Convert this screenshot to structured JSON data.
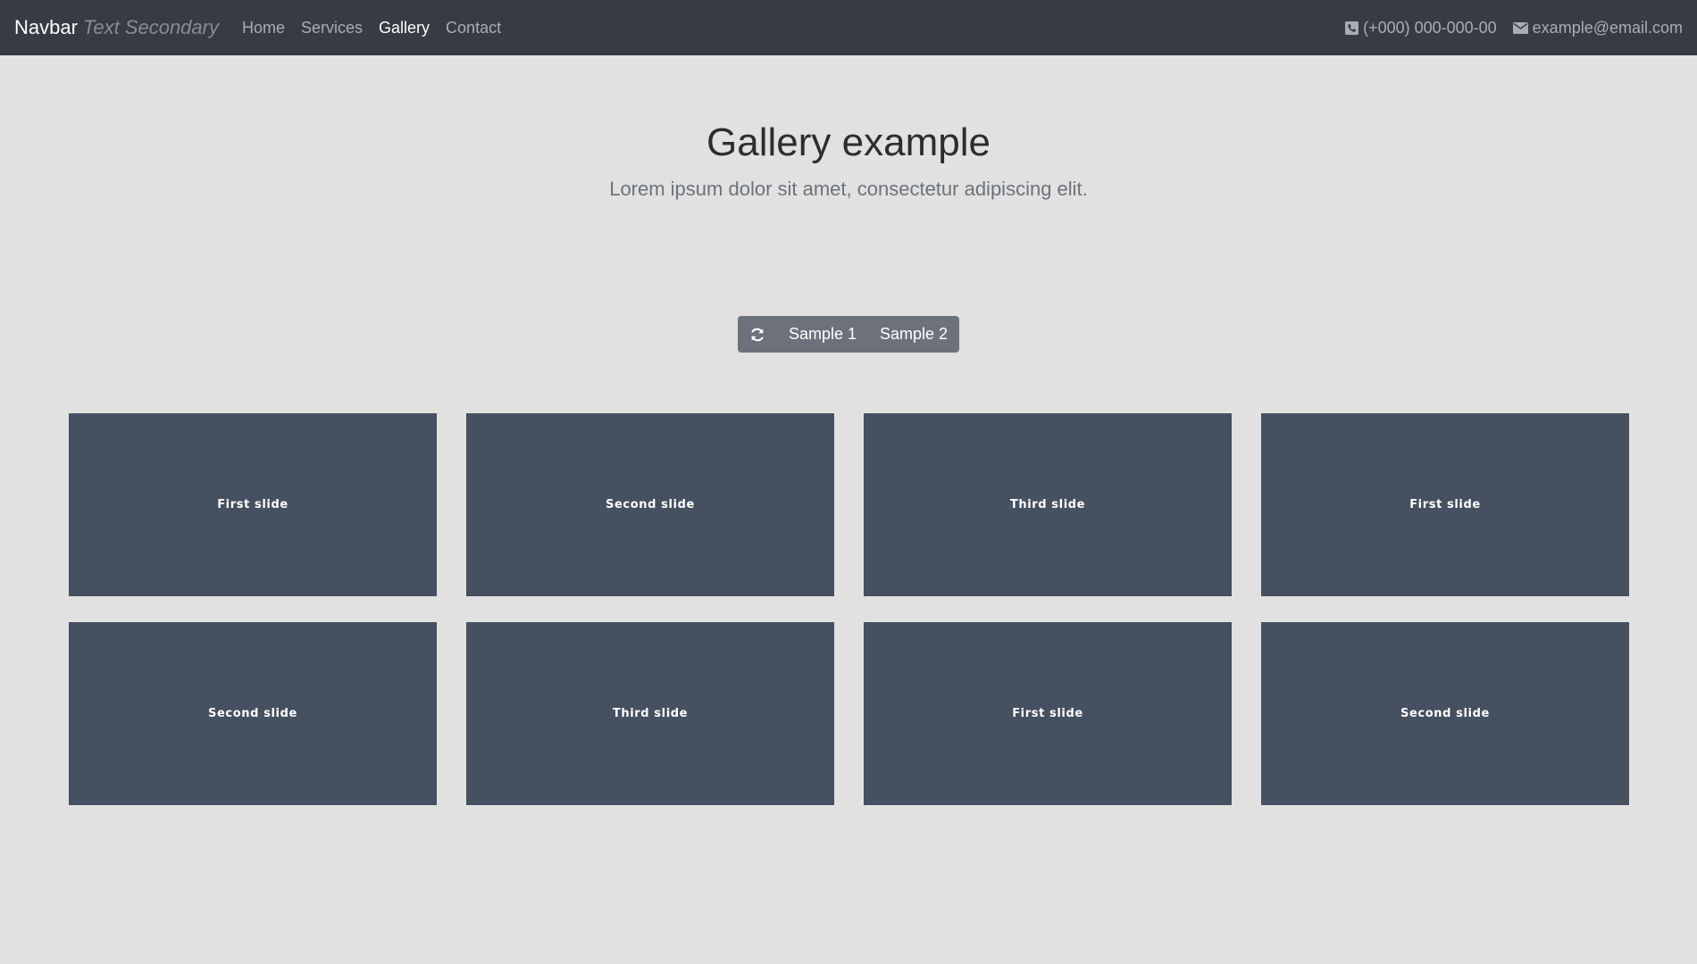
{
  "navbar": {
    "brand": "Navbar",
    "brand_secondary": "Text Secondary",
    "links": [
      {
        "label": "Home",
        "active": false
      },
      {
        "label": "Services",
        "active": false
      },
      {
        "label": "Gallery",
        "active": true
      },
      {
        "label": "Contact",
        "active": false
      }
    ],
    "phone": "(+000) 000-000-00",
    "email": "example@email.com"
  },
  "hero": {
    "title": "Gallery example",
    "subtitle": "Lorem ipsum dolor sit amet, consectetur adipiscing elit."
  },
  "toolbar": {
    "refresh_icon": "refresh-icon",
    "sample1": "Sample 1",
    "sample2": "Sample 2"
  },
  "gallery": {
    "slides": [
      "First slide",
      "Second slide",
      "Third slide",
      "First slide",
      "Second slide",
      "Third slide",
      "First slide",
      "Second slide"
    ]
  }
}
